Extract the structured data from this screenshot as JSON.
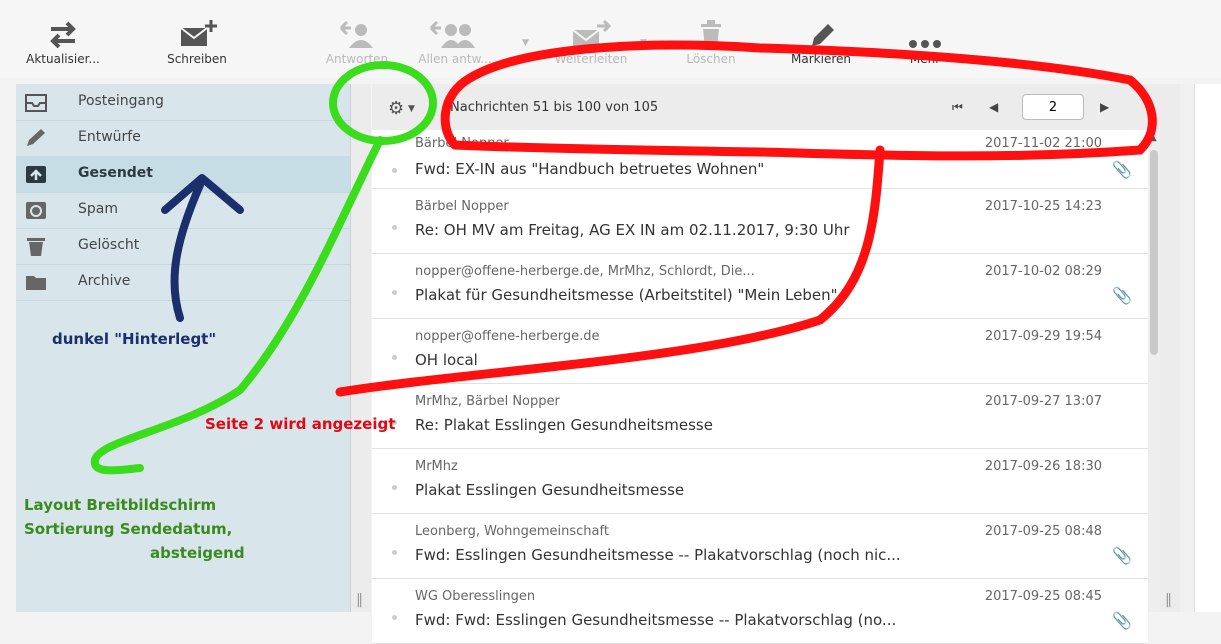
{
  "toolbar": {
    "refresh_label": "Aktualisier...",
    "compose_label": "Schreiben",
    "reply_label": "Antworten",
    "reply_all_label": "Allen antw...",
    "forward_label": "Weiterleiten",
    "delete_label": "Löschen",
    "mark_label": "Markieren",
    "more_label": "Mehr"
  },
  "sidebar": {
    "items": [
      {
        "label": "Posteingang",
        "icon": "inbox-icon"
      },
      {
        "label": "Entwürfe",
        "icon": "pencil-icon"
      },
      {
        "label": "Gesendet",
        "icon": "sent-icon",
        "active": true
      },
      {
        "label": "Spam",
        "icon": "spam-icon"
      },
      {
        "label": "Gelöscht",
        "icon": "trash-icon"
      },
      {
        "label": "Archive",
        "icon": "folder-icon"
      }
    ]
  },
  "list": {
    "count_text": "Nachrichten 51 bis 100 von 105",
    "page_value": "2",
    "messages": [
      {
        "from": "Bärbel Nopper",
        "date": "2017-11-02 21:00",
        "subject": "Fwd: EX-IN aus \"Handbuch betruetes Wohnen\"",
        "attachment": true
      },
      {
        "from": "Bärbel Nopper",
        "date": "2017-10-25 14:23",
        "subject": "Re: OH MV am Freitag, AG EX IN am 02.11.2017, 9:30 Uhr",
        "attachment": false
      },
      {
        "from": "nopper@offene-herberge.de, MrMhz, Schlordt, Die...",
        "date": "2017-10-02 08:29",
        "subject": "Plakat für Gesundheitsmesse (Arbeitstitel) \"Mein Leben\"",
        "attachment": true
      },
      {
        "from": "nopper@offene-herberge.de",
        "date": "2017-09-29 19:54",
        "subject": "OH local",
        "attachment": false
      },
      {
        "from": "MrMhz, Bärbel Nopper",
        "date": "2017-09-27 13:07",
        "subject": "Re: Plakat Esslingen Gesundheitsmesse",
        "attachment": false
      },
      {
        "from": "MrMhz",
        "date": "2017-09-26 18:30",
        "subject": "Plakat Esslingen Gesundheitsmesse",
        "attachment": false
      },
      {
        "from": "Leonberg, Wohngemeinschaft",
        "date": "2017-09-25 08:48",
        "subject": "Fwd: Esslingen Gesundheitsmesse -- Plakatvorschlag (noch nic...",
        "attachment": true
      },
      {
        "from": "WG Oberesslingen",
        "date": "2017-09-25 08:45",
        "subject": "Fwd: Fwd: Esslingen Gesundheitsmesse -- Plakatvorschlag (no...",
        "attachment": true
      }
    ]
  },
  "annotations": {
    "blue_text": "dunkel \"Hinterlegt\"",
    "red_text": "Seite 2 wird angezeigt",
    "green_line1": "Layout Breitbildschirm",
    "green_line2": "Sortierung Sendedatum,",
    "green_line3": "absteigend"
  },
  "colors": {
    "sidebar_bg": "#d8e6ec",
    "sidebar_active": "#c6dde6",
    "annotation_red": "#e30613",
    "annotation_green": "#3bdc1c",
    "annotation_blue": "#1a2f6b"
  }
}
